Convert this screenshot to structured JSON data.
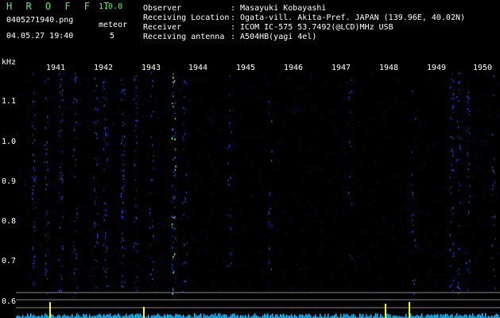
{
  "app": {
    "title": "H R O F F T",
    "version": "1.0.0"
  },
  "file": {
    "name": "0405271940.png",
    "datetime": "04.05.27 19:40"
  },
  "meteor": {
    "label": "meteor",
    "count": "5"
  },
  "info": [
    {
      "label": "Observer",
      "value": ": Masayuki Kobayashi"
    },
    {
      "label": "Receiving Location",
      "value": ": Ogata-vill. Akita-Pref. JAPAN (139.96E, 40.02N)"
    },
    {
      "label": "Receiver",
      "value": ": ICOM IC-575 53.7492(@LCD)MHz USB"
    },
    {
      "label": "Receiving antenna",
      "value": ": A504HB(yagi 4el)"
    }
  ],
  "axis": {
    "unit": "kHz",
    "y_ticks": [
      "1.1",
      "1.0",
      "0.9",
      "0.8",
      "0.7",
      "0.6"
    ],
    "x_ticks": [
      "1941",
      "1942",
      "1943",
      "1944",
      "1945",
      "1946",
      "1947",
      "1948",
      "1949",
      "1950"
    ]
  },
  "colors": {
    "title": "#40ff40",
    "spectrum_low": "#0a1f80",
    "spectrum_high": "#40ff40",
    "peak": "#ffff00"
  }
}
